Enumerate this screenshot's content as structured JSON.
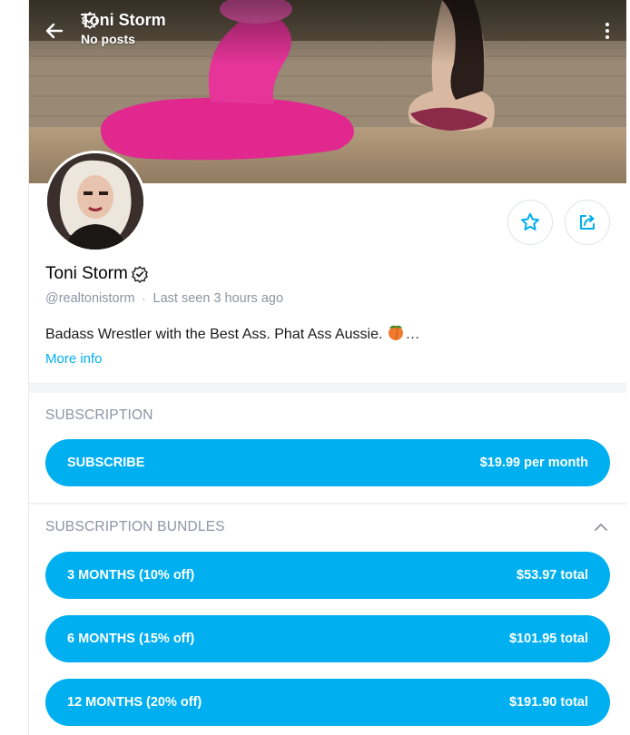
{
  "header": {
    "name": "Toni Storm",
    "subtitle": "No posts"
  },
  "profile": {
    "name": "Toni Storm",
    "handle": "@realtonistorm",
    "separator": "·",
    "last_seen": "Last seen 3 hours ago",
    "bio": "Badass Wrestler with the Best Ass. Phat Ass Aussie.",
    "bio_ellipsis": "…",
    "more_info": "More info"
  },
  "subscription": {
    "title": "SUBSCRIPTION",
    "button_label": "SUBSCRIBE",
    "button_price": "$19.99 per month"
  },
  "bundles": {
    "title": "SUBSCRIPTION BUNDLES",
    "items": [
      {
        "label": "3 MONTHS (10% off)",
        "price": "$53.97 total"
      },
      {
        "label": "6 MONTHS (15% off)",
        "price": "$101.95 total"
      },
      {
        "label": "12 MONTHS (20% off)",
        "price": "$191.90 total"
      }
    ]
  },
  "icons": {
    "back": "arrow-left-icon",
    "verified": "verified-badge-icon",
    "more": "more-vertical-icon",
    "favorite": "star-icon",
    "share": "share-icon",
    "collapse": "chevron-up-icon",
    "peach": "peach-emoji-icon"
  },
  "colors": {
    "accent": "#00aff0",
    "muted": "#8a96a3"
  }
}
